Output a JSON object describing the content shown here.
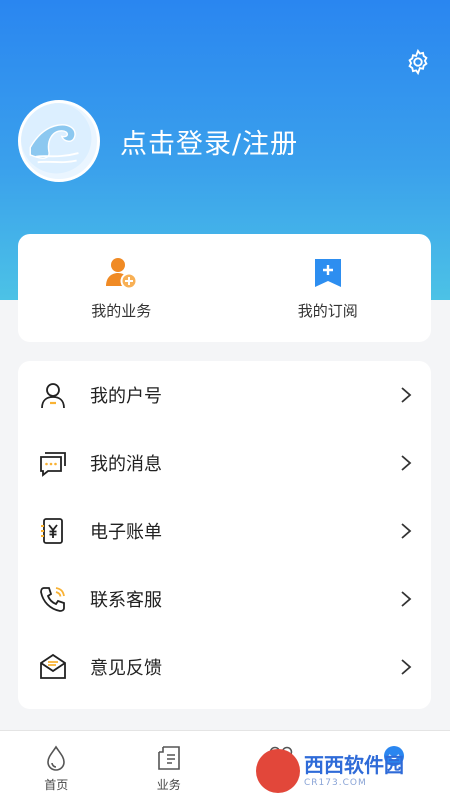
{
  "header": {
    "login_text": "点击登录/注册",
    "settings_icon": "gear-icon",
    "avatar_icon": "wave-avatar"
  },
  "quick_actions": [
    {
      "label": "我的业务",
      "icon": "person-add-icon",
      "color": "#f08a24"
    },
    {
      "label": "我的订阅",
      "icon": "bookmark-add-icon",
      "color": "#2d8ef0"
    }
  ],
  "menu": [
    {
      "label": "我的户号",
      "icon": "user-icon"
    },
    {
      "label": "我的消息",
      "icon": "message-icon"
    },
    {
      "label": "电子账单",
      "icon": "bill-icon"
    },
    {
      "label": "联系客服",
      "icon": "phone-icon"
    },
    {
      "label": "意见反馈",
      "icon": "envelope-icon"
    }
  ],
  "tabbar": [
    {
      "label": "首页",
      "icon": "water-drop-icon"
    },
    {
      "label": "业务",
      "icon": "document-icon"
    },
    {
      "label": "",
      "icon": "grid-icon"
    },
    {
      "label": "",
      "icon": "profile-icon",
      "active": true
    }
  ],
  "watermark": {
    "main": "西西软件园",
    "sub": "CR173.COM"
  },
  "colors": {
    "accent": "#2a86f0",
    "secondary": "#f9b234",
    "background": "#f4f5f7"
  }
}
